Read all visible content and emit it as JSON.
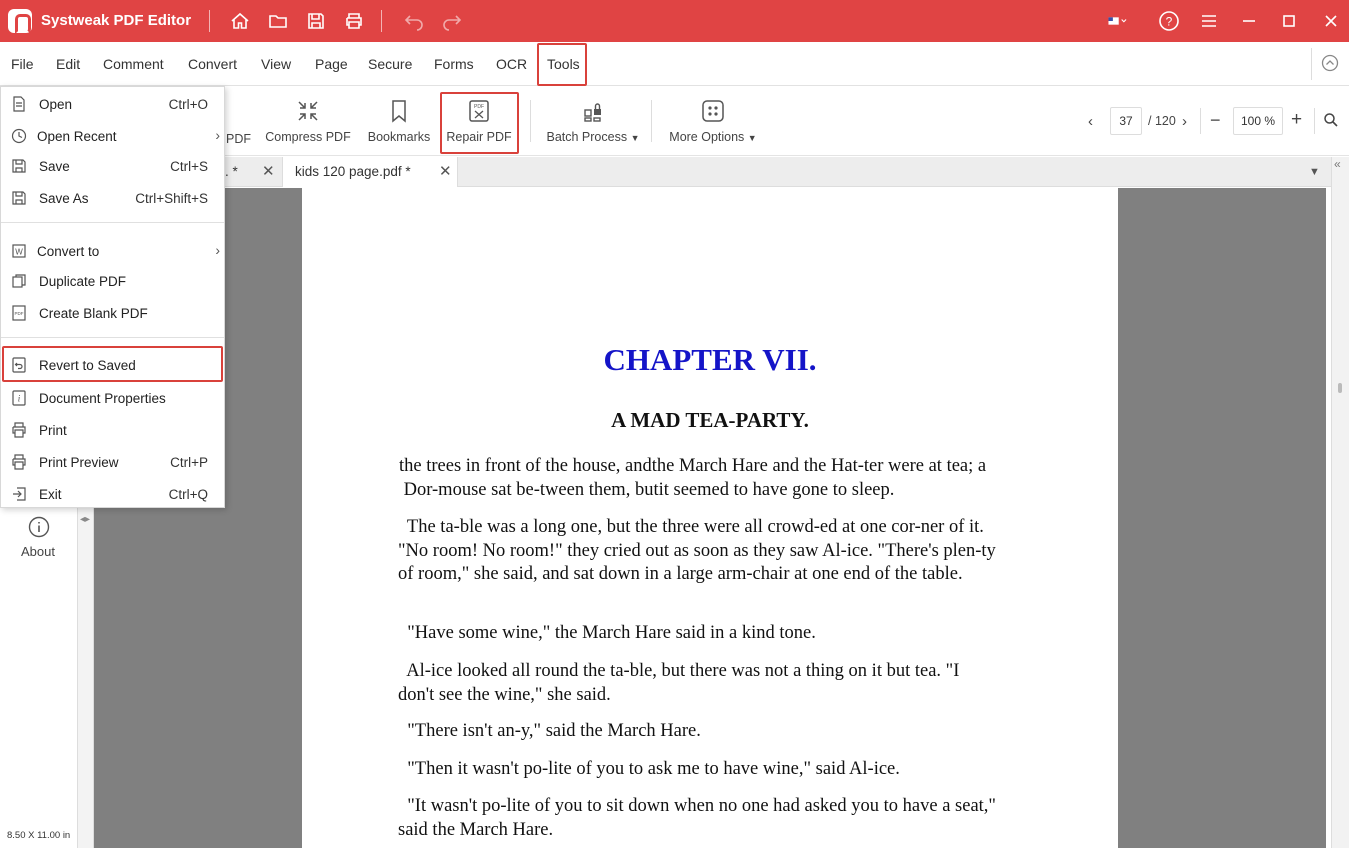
{
  "app": {
    "title": "Systweak PDF Editor"
  },
  "menubar": {
    "items": [
      "File",
      "Edit",
      "Comment",
      "Convert",
      "View",
      "Page",
      "Secure",
      "Forms",
      "OCR",
      "Tools"
    ]
  },
  "toolbar": {
    "partial_label": "PDF",
    "compress": "Compress PDF",
    "bookmarks": "Bookmarks",
    "repair": "Repair PDF",
    "batch": "Batch Process",
    "more": "More Options",
    "current_page": "37",
    "total_pages": "/ 120",
    "zoom": "100 %"
  },
  "tabs": [
    {
      "label": ". *"
    },
    {
      "label": "kids 120 page.pdf  *"
    }
  ],
  "file_menu": {
    "items": [
      {
        "label": "Open",
        "shortcut": "Ctrl+O"
      },
      {
        "label": "Open Recent",
        "shortcut": ""
      },
      {
        "label": "Save",
        "shortcut": "Ctrl+S"
      },
      {
        "label": "Save As",
        "shortcut": "Ctrl+Shift+S"
      },
      {
        "label": "Convert to",
        "shortcut": ""
      },
      {
        "label": "Duplicate PDF",
        "shortcut": ""
      },
      {
        "label": "Create Blank PDF",
        "shortcut": ""
      },
      {
        "label": "Revert to Saved",
        "shortcut": ""
      },
      {
        "label": "Document Properties",
        "shortcut": ""
      },
      {
        "label": "Print",
        "shortcut": ""
      },
      {
        "label": "Print Preview",
        "shortcut": "Ctrl+P"
      },
      {
        "label": "Exit",
        "shortcut": "Ctrl+Q"
      }
    ]
  },
  "left_panel": {
    "about": "About",
    "page_size": "8.50 X 11.00 in"
  },
  "document": {
    "chapter_title": "CHAPTER VII.",
    "subtitle": "A MAD TEA-PARTY.",
    "paragraphs": [
      [
        "the trees in front of the house, andthe March Hare and the Hat-ter were at tea; a",
        " Dor-mouse sat be-tween them, butit seemed to have gone to sleep."
      ],
      [
        "  The ta-ble was a long one, but the three were all crowd-ed at one cor-ner of it.",
        "\"No room! No room!\" they cried out as soon as they saw Al-ice. \"There's plen-ty",
        "of room,\" she said, and sat down in a large arm-chair at one end of the table."
      ],
      [
        "  \"Have some wine,\" the March Hare said in a kind tone."
      ],
      [
        "  Al-ice looked all round the ta-ble, but there was not a thing on it but tea. \"I",
        "don't see the wine,\" she said."
      ],
      [
        "  \"There isn't an-y,\" said the March Hare."
      ],
      [
        "  \"Then it wasn't po-lite of you to ask me to have wine,\" said Al-ice."
      ],
      [
        "  \"It wasn't po-lite of you to sit down when no one had asked you to have a seat,\"",
        "said the March Hare."
      ]
    ]
  },
  "colors": {
    "brand": "#e04444",
    "highlight": "#d9413b",
    "chapter": "#1414c8"
  }
}
